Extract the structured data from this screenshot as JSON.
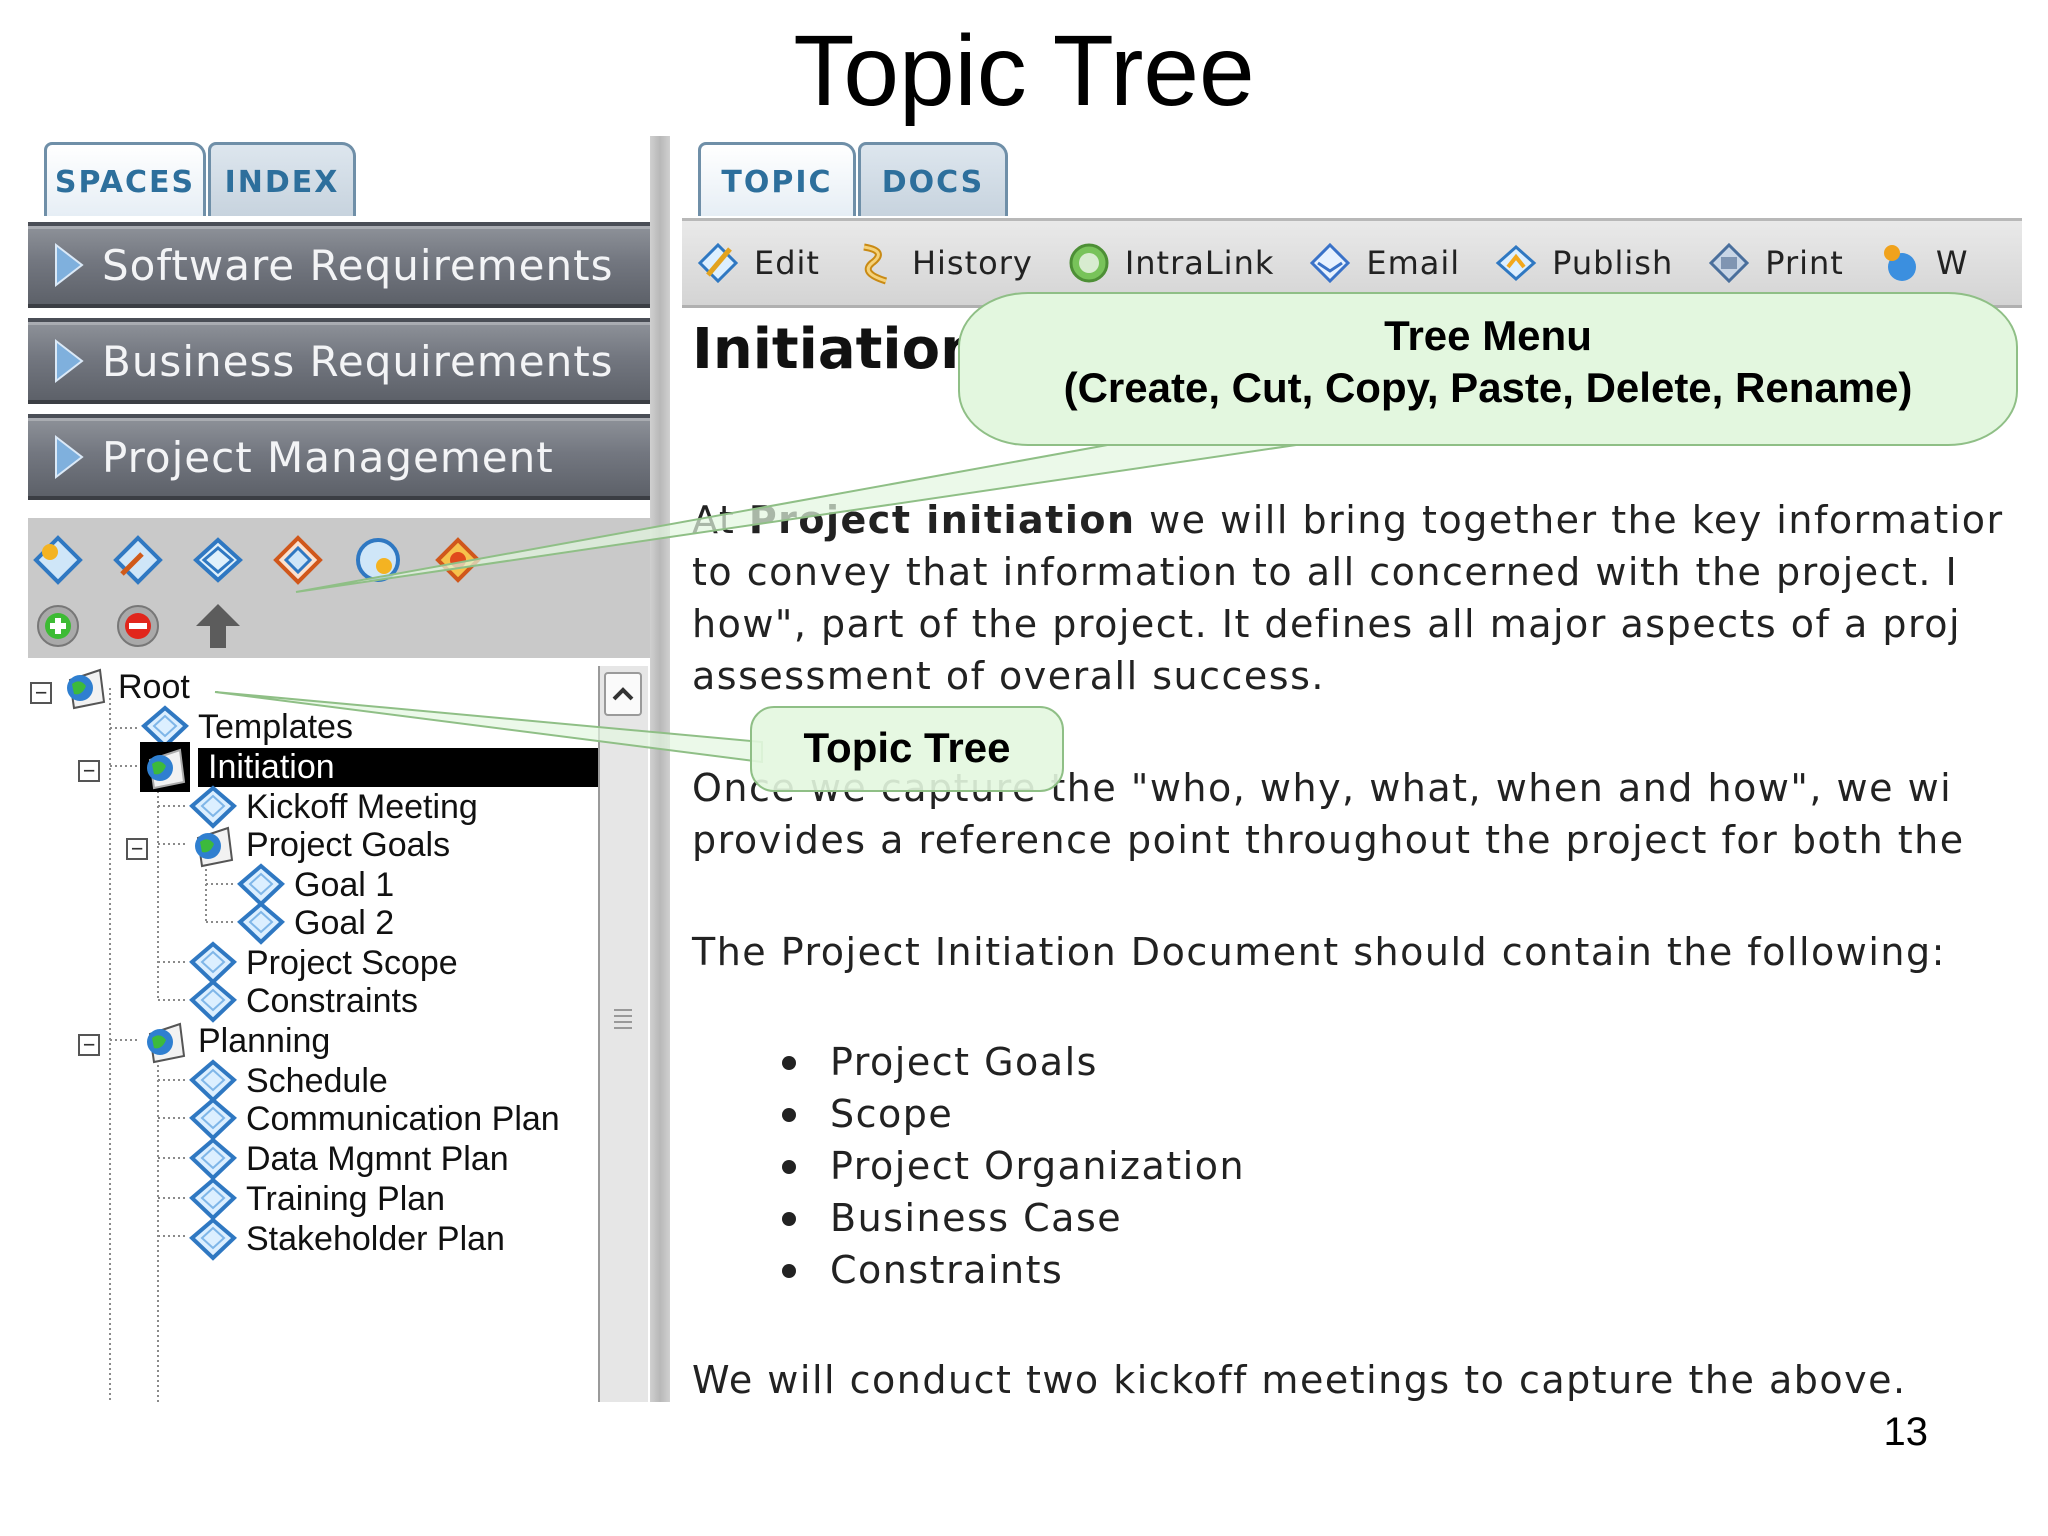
{
  "slide": {
    "title": "Topic Tree",
    "page_number": "13"
  },
  "left_panel": {
    "tabs": [
      {
        "label": "SPACES"
      },
      {
        "label": "INDEX"
      }
    ],
    "spaces": [
      {
        "label": "Software Requirements"
      },
      {
        "label": "Business Requirements"
      },
      {
        "label": "Project Management"
      }
    ],
    "tree": {
      "items": [
        {
          "label": "Root"
        },
        {
          "label": "Templates"
        },
        {
          "label": "Initiation"
        },
        {
          "label": "Kickoff Meeting"
        },
        {
          "label": "Project Goals"
        },
        {
          "label": "Goal 1"
        },
        {
          "label": "Goal 2"
        },
        {
          "label": "Project Scope"
        },
        {
          "label": "Constraints"
        },
        {
          "label": "Planning"
        },
        {
          "label": "Schedule"
        },
        {
          "label": "Communication Plan"
        },
        {
          "label": "Data Mgmnt Plan"
        },
        {
          "label": "Training Plan"
        },
        {
          "label": "Stakeholder Plan"
        }
      ],
      "expander_minus": "−"
    }
  },
  "right_panel": {
    "tabs": [
      {
        "label": "TOPIC"
      },
      {
        "label": "DOCS"
      }
    ],
    "toolbar": [
      {
        "label": "Edit",
        "icon": "edit-icon"
      },
      {
        "label": "History",
        "icon": "history-icon"
      },
      {
        "label": "IntraLink",
        "icon": "intralink-icon"
      },
      {
        "label": "Email",
        "icon": "email-icon"
      },
      {
        "label": "Publish",
        "icon": "publish-icon"
      },
      {
        "label": "Print",
        "icon": "print-icon"
      },
      {
        "label": "W",
        "icon": "more-icon"
      }
    ],
    "document": {
      "heading": "Initiation",
      "p1_lines": [
        "At ",
        "Project initiation",
        " we will bring together the key informatior",
        "to convey that information to all concerned with the project. I",
        "how\", part of the project. It defines all major aspects of a proj",
        "assessment of overall success."
      ],
      "p2_lines": [
        "Once we capture the \"who, why, what, when and how\", we wi",
        "provides a reference point throughout the project for both the"
      ],
      "p3": "The Project Initiation Document should contain the following:",
      "bullets": [
        "Project Goals",
        "Scope",
        "Project Organization",
        "Business Case",
        "Constraints"
      ],
      "p4": "We will conduct two kickoff meetings to capture the above."
    }
  },
  "callouts": {
    "tree_menu_line1": "Tree Menu",
    "tree_menu_line2": "(Create, Cut, Copy, Paste, Delete, Rename)",
    "topic_tree": "Topic Tree"
  },
  "colors": {
    "tab_text": "#2d6f9c",
    "callout_fill": "#e3f7df",
    "space_bar": "#737780",
    "selected_row": "#000000"
  }
}
